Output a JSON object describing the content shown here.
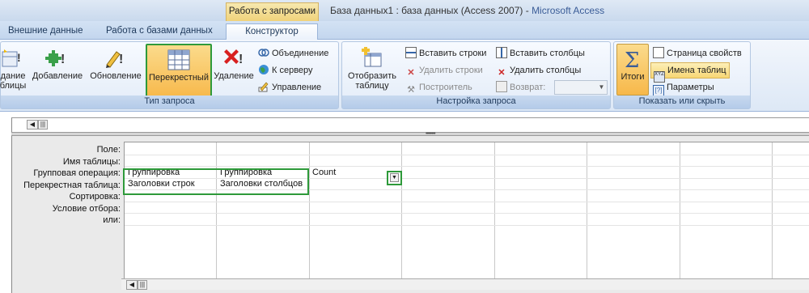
{
  "titlebar": {
    "context_tab": "Работа с запросами",
    "doc_title": "База данных1 : база данных (Access 2007) - ",
    "app_name": "Microsoft Access"
  },
  "tabs": {
    "external": "Внешние данные",
    "database_tools": "Работа с базами данных",
    "designer": "Конструктор"
  },
  "ribbon": {
    "query_type": {
      "label": "Тип запроса",
      "create_table_line1": "дание",
      "create_table_line2": "блицы",
      "append": "Добавление",
      "update": "Обновление",
      "crosstab": "Перекрестный",
      "delete": "Удаление",
      "union": "Объединение",
      "pass_through": "К серверу",
      "data_definition": "Управление"
    },
    "query_setup": {
      "label": "Настройка запроса",
      "show_table_line1": "Отобразить",
      "show_table_line2": "таблицу",
      "insert_rows": "Вставить строки",
      "delete_rows": "Удалить строки",
      "builder": "Построитель",
      "insert_columns": "Вставить столбцы",
      "delete_columns": "Удалить столбцы",
      "return_label": "Возврат:",
      "return_value": ""
    },
    "show_hide": {
      "label": "Показать или скрыть",
      "totals": "Итоги",
      "property_sheet": "Страница свойств",
      "table_names": "Имена таблиц",
      "parameters": "Параметры"
    }
  },
  "design_grid": {
    "row_labels": {
      "field": "Поле:",
      "table": "Имя таблицы:",
      "total": "Групповая операция:",
      "crosstab": "Перекрестная таблица:",
      "sort": "Сортировка:",
      "criteria": "Условие отбора:",
      "or": "или:"
    },
    "col1": {
      "total": "Группировка",
      "crosstab": "Заголовки строк"
    },
    "col2": {
      "total": "Группировка",
      "crosstab": "Заголовки столбцов"
    },
    "col3": {
      "total": "Count",
      "crosstab": ""
    }
  },
  "icons": [
    "sigma-icon",
    "table-grid-icon",
    "delete-x-icon",
    "globe-icon",
    "union-icon",
    "pencil-icon",
    "dropdown-arrow-icon"
  ]
}
